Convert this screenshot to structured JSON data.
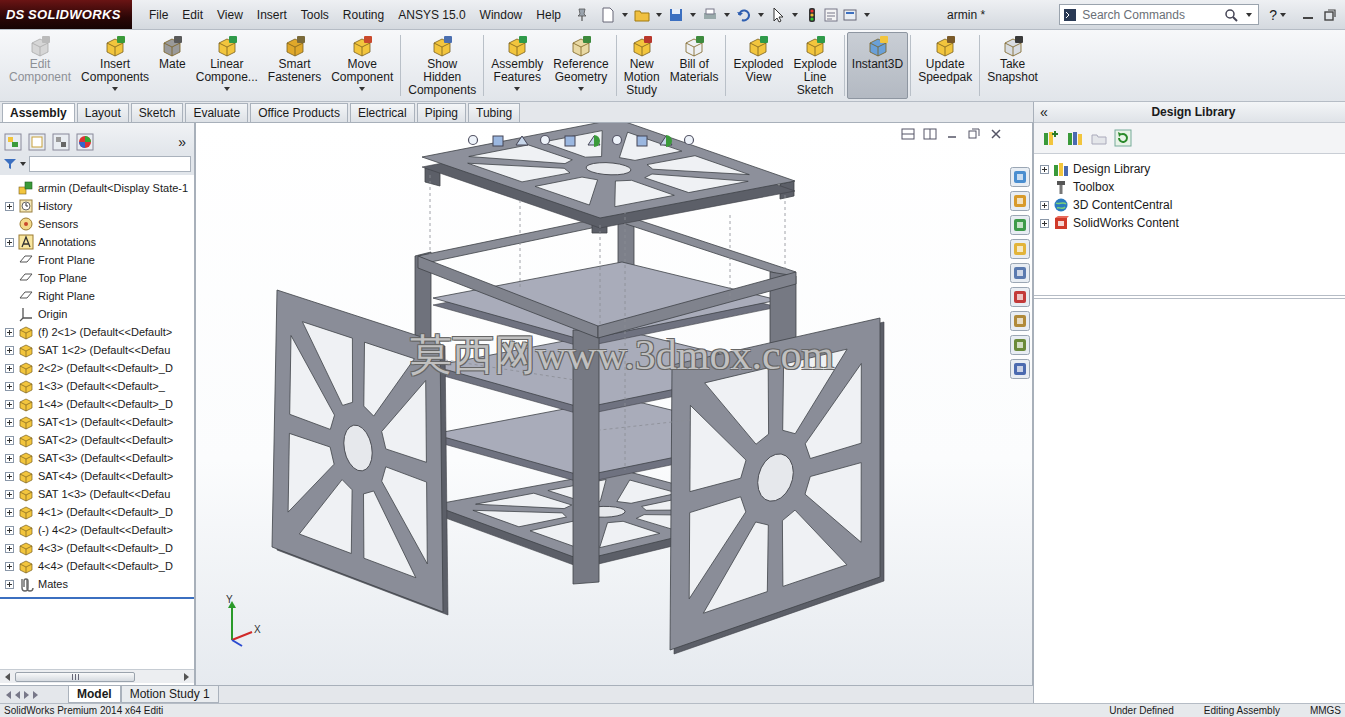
{
  "window": {
    "title": "armin *"
  },
  "logo": {
    "mark": "DS",
    "name": "SOLIDWORKS"
  },
  "menu": [
    "File",
    "Edit",
    "View",
    "Insert",
    "Tools",
    "Routing",
    "ANSYS 15.0",
    "Window",
    "Help"
  ],
  "search": {
    "placeholder": "Search Commands"
  },
  "help": "?",
  "commands": [
    {
      "label": [
        "Edit",
        "Component"
      ],
      "disabled": true,
      "selected": false,
      "dropdown": false
    },
    {
      "label": [
        "Insert",
        "Components"
      ],
      "disabled": false,
      "selected": false,
      "dropdown": true
    },
    {
      "label": [
        "Mate"
      ],
      "disabled": false,
      "selected": false,
      "dropdown": false
    },
    {
      "label": [
        "Linear",
        "Compone..."
      ],
      "disabled": false,
      "selected": false,
      "dropdown": true
    },
    {
      "label": [
        "Smart",
        "Fasteners"
      ],
      "disabled": false,
      "selected": false,
      "dropdown": false
    },
    {
      "label": [
        "Move",
        "Component"
      ],
      "disabled": false,
      "selected": false,
      "dropdown": true
    },
    {
      "label": [
        "Show",
        "Hidden",
        "Components"
      ],
      "disabled": false,
      "selected": false,
      "dropdown": false
    },
    {
      "label": [
        "Assembly",
        "Features"
      ],
      "disabled": false,
      "selected": false,
      "dropdown": true
    },
    {
      "label": [
        "Reference",
        "Geometry"
      ],
      "disabled": false,
      "selected": false,
      "dropdown": true
    },
    {
      "label": [
        "New",
        "Motion",
        "Study"
      ],
      "disabled": false,
      "selected": false,
      "dropdown": false
    },
    {
      "label": [
        "Bill of",
        "Materials"
      ],
      "disabled": false,
      "selected": false,
      "dropdown": false
    },
    {
      "label": [
        "Exploded",
        "View"
      ],
      "disabled": false,
      "selected": false,
      "dropdown": false
    },
    {
      "label": [
        "Explode",
        "Line",
        "Sketch"
      ],
      "disabled": false,
      "selected": false,
      "dropdown": false
    },
    {
      "label": [
        "Instant3D"
      ],
      "disabled": false,
      "selected": true,
      "dropdown": false
    },
    {
      "label": [
        "Update",
        "Speedpak"
      ],
      "disabled": false,
      "selected": false,
      "dropdown": false
    },
    {
      "label": [
        "Take",
        "Snapshot"
      ],
      "disabled": false,
      "selected": false,
      "dropdown": false
    }
  ],
  "ribbon_tabs": [
    {
      "label": "Assembly",
      "selected": true
    },
    {
      "label": "Layout",
      "selected": false
    },
    {
      "label": "Sketch",
      "selected": false
    },
    {
      "label": "Evaluate",
      "selected": false
    },
    {
      "label": "Office Products",
      "selected": false
    },
    {
      "label": "Electrical",
      "selected": false
    },
    {
      "label": "Piping",
      "selected": false
    },
    {
      "label": "Tubing",
      "selected": false
    }
  ],
  "feature_tree": {
    "expand": "»",
    "items": [
      {
        "label": "armin  (Default<Display State-1",
        "kind": "assembly",
        "expandable": false,
        "expanded": false
      },
      {
        "label": "History",
        "kind": "history",
        "expandable": true,
        "expanded": false
      },
      {
        "label": "Sensors",
        "kind": "sensors",
        "expandable": false,
        "expanded": false
      },
      {
        "label": "Annotations",
        "kind": "annotations",
        "expandable": true,
        "expanded": false
      },
      {
        "label": "Front Plane",
        "kind": "plane",
        "expandable": false,
        "expanded": false
      },
      {
        "label": "Top Plane",
        "kind": "plane",
        "expandable": false,
        "expanded": false
      },
      {
        "label": "Right Plane",
        "kind": "plane",
        "expandable": false,
        "expanded": false
      },
      {
        "label": "Origin",
        "kind": "origin",
        "expandable": false,
        "expanded": false
      },
      {
        "label": "(f) 2<1> (Default<<Default>",
        "kind": "part",
        "expandable": true,
        "expanded": false
      },
      {
        "label": "SAT 1<2> (Default<<Defau",
        "kind": "part",
        "expandable": true,
        "expanded": false
      },
      {
        "label": "2<2> (Default<<Default>_D",
        "kind": "part",
        "expandable": true,
        "expanded": false
      },
      {
        "label": "1<3> (Default<<Default>_",
        "kind": "part",
        "expandable": true,
        "expanded": false
      },
      {
        "label": "1<4> (Default<<Default>_D",
        "kind": "part",
        "expandable": true,
        "expanded": false
      },
      {
        "label": "SAT<1> (Default<<Default>",
        "kind": "part",
        "expandable": true,
        "expanded": false
      },
      {
        "label": "SAT<2> (Default<<Default>",
        "kind": "part",
        "expandable": true,
        "expanded": false
      },
      {
        "label": "SAT<3> (Default<<Default>",
        "kind": "part",
        "expandable": true,
        "expanded": false
      },
      {
        "label": "SAT<4> (Default<<Default>",
        "kind": "part",
        "expandable": true,
        "expanded": false
      },
      {
        "label": "SAT 1<3> (Default<<Defau",
        "kind": "part",
        "expandable": true,
        "expanded": false
      },
      {
        "label": "4<1> (Default<<Default>_D",
        "kind": "part",
        "expandable": true,
        "expanded": false
      },
      {
        "label": "(-) 4<2> (Default<<Default>",
        "kind": "part",
        "expandable": true,
        "expanded": false
      },
      {
        "label": "4<3> (Default<<Default>_D",
        "kind": "part",
        "expandable": true,
        "expanded": false
      },
      {
        "label": "4<4> (Default<<Default>_D",
        "kind": "part",
        "expandable": true,
        "expanded": false
      },
      {
        "label": "Mates",
        "kind": "mates",
        "expandable": true,
        "expanded": false
      }
    ]
  },
  "design_library": {
    "collapse": "«",
    "title": "Design Library",
    "items": [
      {
        "label": "Design Library",
        "kind": "library",
        "expandable": true,
        "expanded": false
      },
      {
        "label": "Toolbox",
        "kind": "toolbox",
        "expandable": false,
        "expanded": false
      },
      {
        "label": "3D ContentCentral",
        "kind": "globe",
        "expandable": true,
        "expanded": false
      },
      {
        "label": "SolidWorks Content",
        "kind": "content",
        "expandable": true,
        "expanded": false
      }
    ]
  },
  "viewport": {
    "watermark": "莫西网www.3dmox.com",
    "triad": {
      "y": "Y",
      "x": "X"
    }
  },
  "bottom_tabs": [
    {
      "label": "Model",
      "selected": true
    },
    {
      "label": "Motion Study 1",
      "selected": false
    }
  ],
  "status_bar": {
    "product": "SolidWorks Premium 2014 x64 Editi",
    "state": "Under Defined",
    "mode": "Editing Assembly",
    "units": "MMGS"
  }
}
